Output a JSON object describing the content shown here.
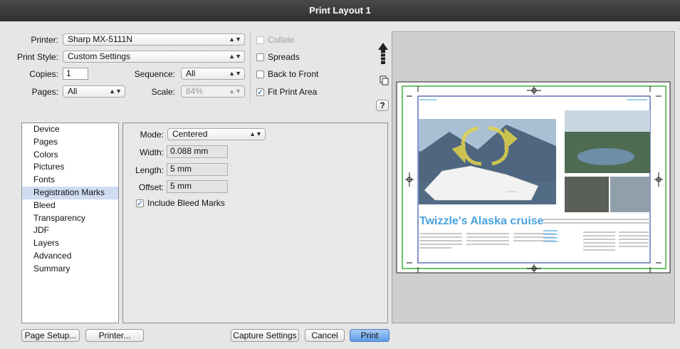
{
  "window": {
    "title": "Print Layout 1"
  },
  "printer": {
    "label": "Printer:",
    "value": "Sharp MX-5111N"
  },
  "print_style": {
    "label": "Print Style:",
    "value": "Custom Settings"
  },
  "copies": {
    "label": "Copies:",
    "value": "1"
  },
  "sequence": {
    "label": "Sequence:",
    "value": "All"
  },
  "pages": {
    "label": "Pages:",
    "value": "All"
  },
  "scale": {
    "label": "Scale:",
    "value": "84%"
  },
  "checkboxes": {
    "collate": "Collate",
    "spreads": "Spreads",
    "back_to_front": "Back to Front",
    "fit_print_area": "Fit Print Area"
  },
  "help_label": "?",
  "sidebar": {
    "items": [
      "Device",
      "Pages",
      "Colors",
      "Pictures",
      "Fonts",
      "Registration Marks",
      "Bleed",
      "Transparency",
      "JDF",
      "Layers",
      "Advanced",
      "Summary"
    ],
    "selected": "Registration Marks"
  },
  "marks": {
    "mode": {
      "label": "Mode:",
      "value": "Centered"
    },
    "width": {
      "label": "Width:",
      "value": "0.088 mm"
    },
    "length": {
      "label": "Length:",
      "value": "5 mm"
    },
    "offset": {
      "label": "Offset:",
      "value": "5 mm"
    },
    "include_bleed": "Include Bleed Marks"
  },
  "preview": {
    "headline": "Twizzle's Alaska cruise"
  },
  "buttons": {
    "page_setup": "Page Setup...",
    "printer": "Printer...",
    "capture": "Capture Settings",
    "cancel": "Cancel",
    "print": "Print"
  },
  "colors": {
    "accent": "#4a90d9",
    "selection": "#cfdcf2",
    "crop_green": "#6dc36a"
  }
}
